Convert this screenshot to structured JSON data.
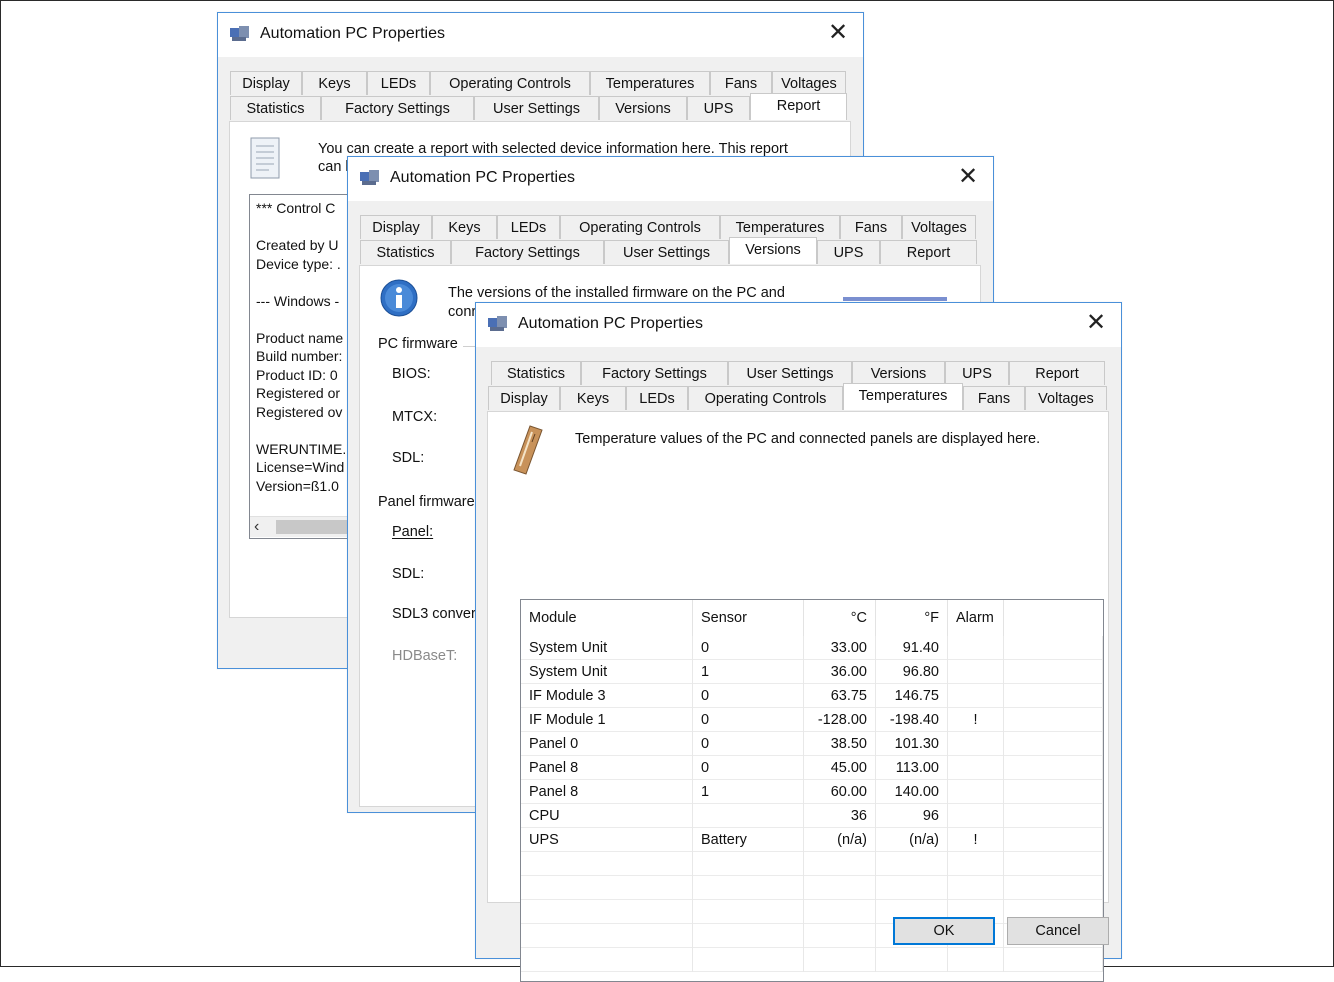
{
  "dialogs": {
    "report": {
      "title": "Automation PC Properties",
      "tabs_row1": [
        "Display",
        "Keys",
        "LEDs",
        "Operating Controls",
        "Temperatures",
        "Fans",
        "Voltages"
      ],
      "tabs_row2": [
        "Statistics",
        "Factory Settings",
        "User Settings",
        "Versions",
        "UPS",
        "Report"
      ],
      "active_tab": "Report",
      "description_line1": "You can create a report with selected device information here. This report",
      "description_line2": "can l",
      "report_lines": [
        "*** Control C",
        "",
        "Created by U",
        "Device type: .",
        "",
        "--- Windows -",
        "",
        "Product name",
        "Build number:",
        "Product ID: 0",
        "Registered or",
        "Registered ov",
        "",
        "WERUNTIME.",
        "License=Wind",
        "Version=ß1.0"
      ]
    },
    "versions": {
      "title": "Automation PC Properties",
      "tabs_row1": [
        "Display",
        "Keys",
        "LEDs",
        "Operating Controls",
        "Temperatures",
        "Fans",
        "Voltages"
      ],
      "tabs_row2": [
        "Statistics",
        "Factory Settings",
        "User Settings",
        "Versions",
        "UPS",
        "Report"
      ],
      "active_tab": "Versions",
      "description_line1": "The versions of the installed firmware on the PC and",
      "description_line2": "conr",
      "pc_firmware_label": "PC firmware",
      "pc_items": [
        "BIOS:",
        "MTCX:",
        "SDL:"
      ],
      "panel_firmware_label": "Panel firmware",
      "panel_items": [
        "Panel:",
        "SDL:",
        "SDL3 conver"
      ],
      "disabled_item": "HDBaseT:"
    },
    "temperatures": {
      "title": "Automation PC Properties",
      "tabs_row_back": [
        "Statistics",
        "Factory Settings",
        "User Settings",
        "Versions",
        "UPS",
        "Report"
      ],
      "tabs_row_front": [
        "Display",
        "Keys",
        "LEDs",
        "Operating Controls",
        "Temperatures",
        "Fans",
        "Voltages"
      ],
      "active_tab": "Temperatures",
      "description": "Temperature values of the PC and connected panels are displayed here.",
      "columns": [
        "Module",
        "Sensor",
        "°C",
        "°F",
        "Alarm"
      ],
      "rows": [
        [
          "System Unit",
          "0",
          "33.00",
          "91.40",
          ""
        ],
        [
          "System Unit",
          "1",
          "36.00",
          "96.80",
          ""
        ],
        [
          "IF Module 3",
          "0",
          "63.75",
          "146.75",
          ""
        ],
        [
          "IF Module 1",
          "0",
          "-128.00",
          "-198.40",
          "!"
        ],
        [
          "Panel 0",
          "0",
          "38.50",
          "101.30",
          ""
        ],
        [
          "Panel 8",
          "0",
          "45.00",
          "113.00",
          ""
        ],
        [
          "Panel 8",
          "1",
          "60.00",
          "140.00",
          ""
        ],
        [
          "CPU",
          "",
          "36",
          "96",
          ""
        ],
        [
          "UPS",
          "Battery",
          "(n/a)",
          "(n/a)",
          "!"
        ]
      ],
      "ok_label": "OK",
      "cancel_label": "Cancel"
    }
  },
  "colors": {
    "window_border": "#4a90d9",
    "dialog_bg": "#f0f0f0",
    "default_button_border": "#0078d7"
  }
}
